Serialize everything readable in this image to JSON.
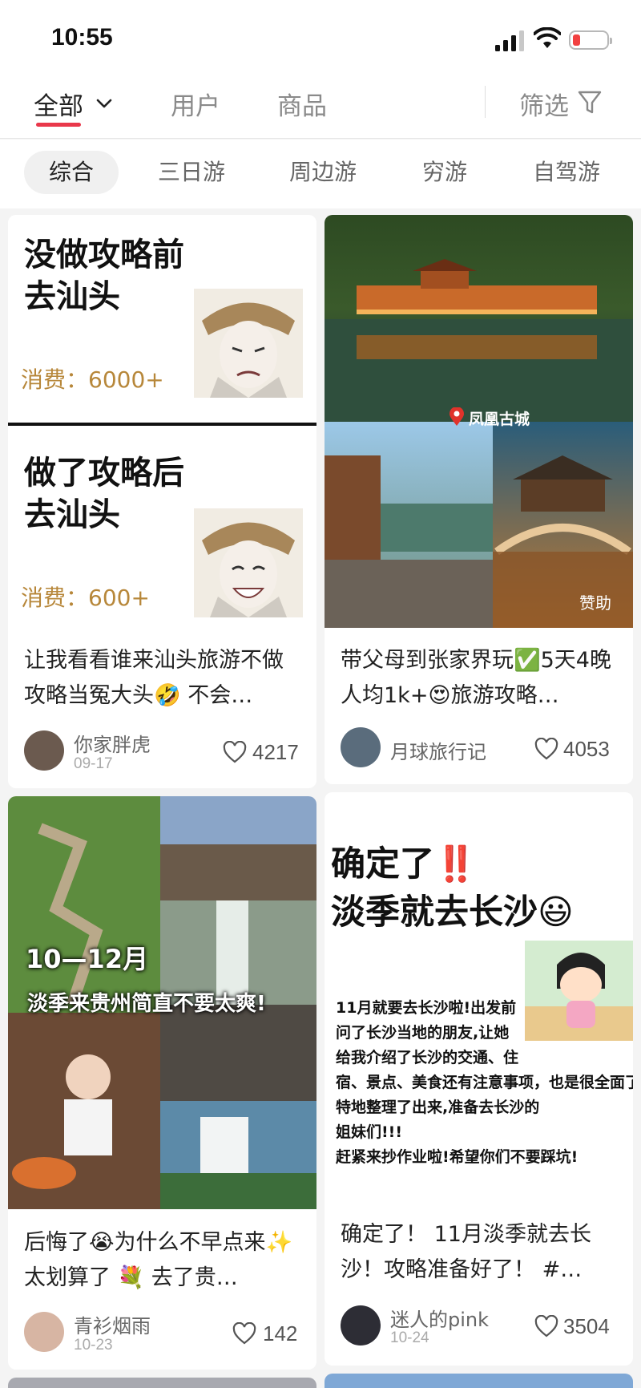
{
  "status": {
    "time": "10:55"
  },
  "nav": {
    "all": "全部",
    "user": "用户",
    "goods": "商品",
    "filter": "筛选"
  },
  "chips": [
    "综合",
    "三日游",
    "周边游",
    "穷游",
    "自驾游"
  ],
  "cards": [
    {
      "meme_top": "没做攻略前\n去汕头",
      "meme_top_price": "消费：6000+",
      "meme_bottom": "做了攻略后\n去汕头",
      "meme_bottom_price": "消费：600+",
      "title": "让我看看谁来汕头旅游不做攻略当冤大头🤣 不会…",
      "user": "你家胖虎",
      "date": "09-17",
      "likes": "4217"
    },
    {
      "location_tag": "凤凰古城",
      "ad": "赞助",
      "title": "带父母到张家界玩✅5天4晚人均1k+😍旅游攻略…",
      "user": "月球旅行记",
      "date": "",
      "likes": "4053"
    },
    {
      "overlay_date": "10—12月",
      "overlay_text": "淡季来贵州简直不要太爽!",
      "title": "后悔了😭为什么不早点来✨太划算了 💐 去了贵…",
      "user": "青衫烟雨",
      "date": "10-23",
      "likes": "142"
    },
    {
      "cover_title": "确定了‼️\n淡季就去长沙😃",
      "cover_body": "11月就要去长沙啦!出发前\n问了长沙当地的朋友,让她\n给我介绍了长沙的交通、住\n宿、景点、美食还有注意事项，也是很全面了\n特地整理了出来,准备去长沙的\n姐妹们!!!\n赶紧来抄作业啦!希望你们不要踩坑!",
      "title": "确定了！ 11月淡季就去长沙！攻略准备好了！ #…",
      "user": "迷人的pink",
      "date": "10-24",
      "likes": "3504"
    }
  ]
}
